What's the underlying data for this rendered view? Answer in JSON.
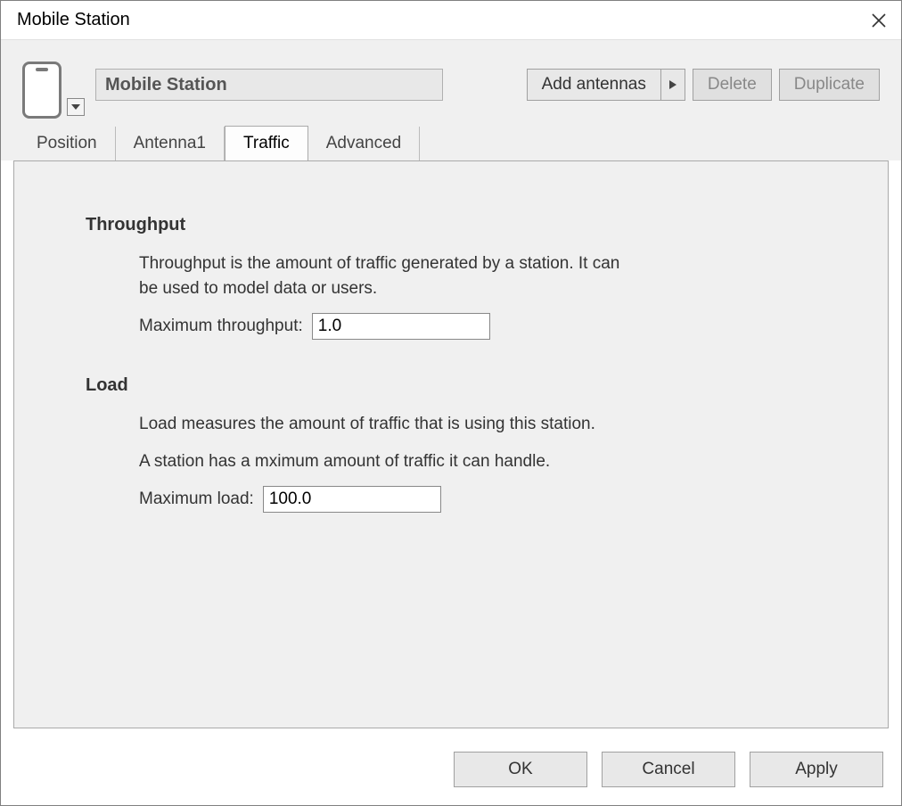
{
  "window": {
    "title": "Mobile Station"
  },
  "header": {
    "name_value": "Mobile Station",
    "add_antennas_label": "Add antennas",
    "delete_label": "Delete",
    "duplicate_label": "Duplicate"
  },
  "tabs": {
    "position": "Position",
    "antenna1": "Antenna1",
    "traffic": "Traffic",
    "advanced": "Advanced"
  },
  "traffic_panel": {
    "throughput_title": "Throughput",
    "throughput_desc": "Throughput is the amount of traffic generated by a station. It can be used to model data or users.",
    "max_throughput_label": "Maximum throughput:",
    "max_throughput_value": "1.0",
    "load_title": "Load",
    "load_desc1": "Load measures the amount of traffic that is using this station.",
    "load_desc2": "A station has a mximum amount of traffic it can handle.",
    "max_load_label": "Maximum load:",
    "max_load_value": "100.0"
  },
  "footer": {
    "ok": "OK",
    "cancel": "Cancel",
    "apply": "Apply"
  }
}
